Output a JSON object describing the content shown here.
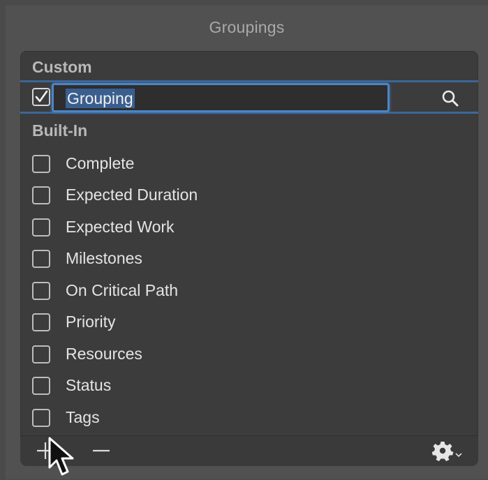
{
  "window": {
    "title": "Groupings"
  },
  "custom": {
    "header": "Custom",
    "items": [
      {
        "label": "Grouping",
        "checked": true,
        "editing": true
      }
    ]
  },
  "builtin": {
    "header": "Built-In",
    "items": [
      {
        "label": "Complete",
        "checked": false
      },
      {
        "label": "Expected Duration",
        "checked": false
      },
      {
        "label": "Expected Work",
        "checked": false
      },
      {
        "label": "Milestones",
        "checked": false
      },
      {
        "label": "On Critical Path",
        "checked": false
      },
      {
        "label": "Priority",
        "checked": false
      },
      {
        "label": "Resources",
        "checked": false
      },
      {
        "label": "Status",
        "checked": false
      },
      {
        "label": "Tags",
        "checked": false
      }
    ]
  },
  "toolbar": {
    "add_icon": "plus-icon",
    "remove_icon": "minus-icon",
    "action_icon": "gear-icon"
  },
  "colors": {
    "selection_border": "#3c6797",
    "focus_ring": "#4e84c4",
    "text_highlight": "#3a5f8f"
  }
}
